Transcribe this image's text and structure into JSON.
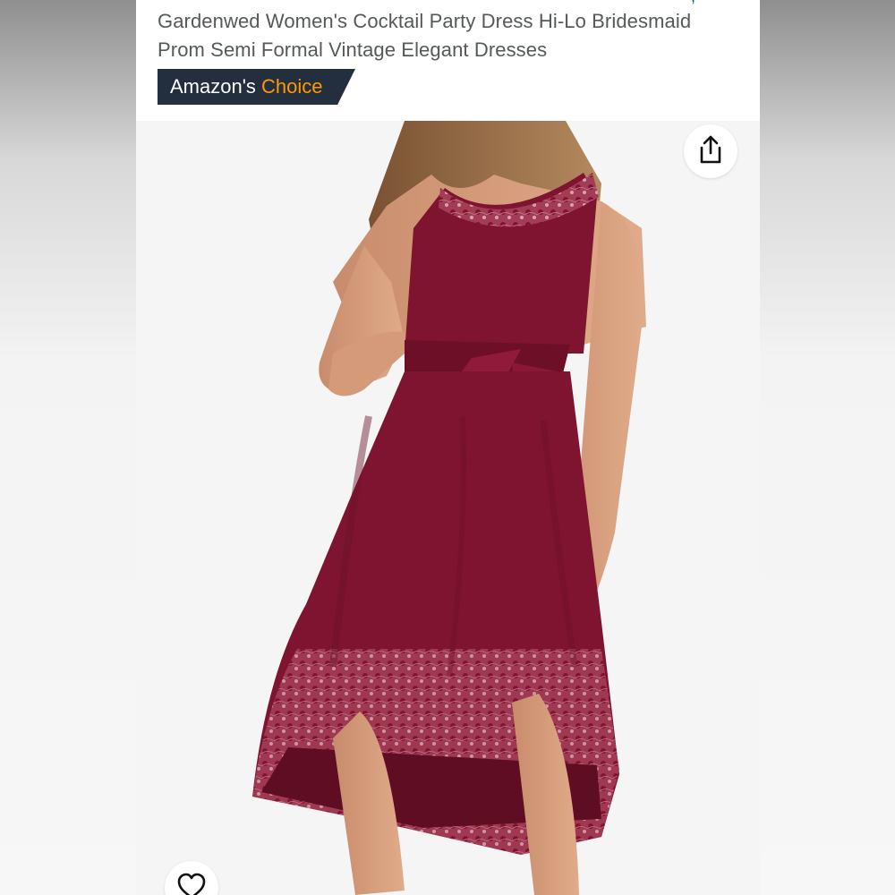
{
  "product": {
    "title": "Gardenwed Women's Cocktail Party Dress Hi-Lo Bridesmaid Prom Semi Formal Vintage Elegant Dresses",
    "badge": {
      "prefix": "Amazon's",
      "highlight": "Choice"
    }
  },
  "colors": {
    "badge_bg": "#232f3e",
    "badge_highlight": "#ff9900",
    "title_text": "#565959",
    "dress": "#7e1430",
    "dress_dark": "#5f0d23"
  },
  "icons": {
    "share": "share-icon",
    "favorite": "heart-icon"
  }
}
